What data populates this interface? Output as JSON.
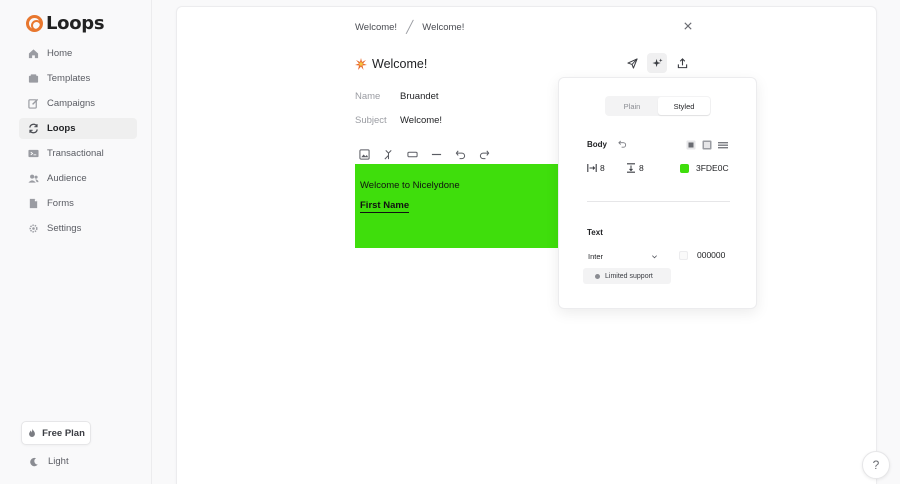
{
  "app": {
    "logo_text": "Loops",
    "brand_color": "#e8772e"
  },
  "sidebar": {
    "items": [
      {
        "label": "Home",
        "icon": "home-icon",
        "active": false
      },
      {
        "label": "Templates",
        "icon": "folder-icon",
        "active": false
      },
      {
        "label": "Campaigns",
        "icon": "edit-icon",
        "active": false
      },
      {
        "label": "Loops",
        "icon": "loop-icon",
        "active": true
      },
      {
        "label": "Transactional",
        "icon": "terminal-icon",
        "active": false
      },
      {
        "label": "Audience",
        "icon": "users-icon",
        "active": false
      },
      {
        "label": "Forms",
        "icon": "forms-icon",
        "active": false
      },
      {
        "label": "Settings",
        "icon": "gear-icon",
        "active": false
      }
    ],
    "plan_label": "Free Plan",
    "theme_label": "Light"
  },
  "header": {
    "breadcrumb": [
      "Welcome!",
      "Welcome!"
    ]
  },
  "email": {
    "title": "Welcome!",
    "emoji": "sparkle-burst-icon",
    "name_label": "Name",
    "name_value": "Bruandet",
    "subject_label": "Subject",
    "subject_value": "Welcome!",
    "canvas_color": "#3fde0c",
    "heading": "Welcome to Nicelydone",
    "merge_tag": "First Name"
  },
  "style_panel": {
    "tabs": [
      {
        "label": "Plain",
        "active": false
      },
      {
        "label": "Styled",
        "active": true
      }
    ],
    "body_label": "Body",
    "padding_x": "8",
    "padding_y": "8",
    "body_color": "3FDE0C",
    "body_color_hex": "#3fde0c",
    "text_label": "Text",
    "font": "Inter",
    "text_color": "000000",
    "badge": "Limited support"
  },
  "help": {
    "label": "?"
  }
}
